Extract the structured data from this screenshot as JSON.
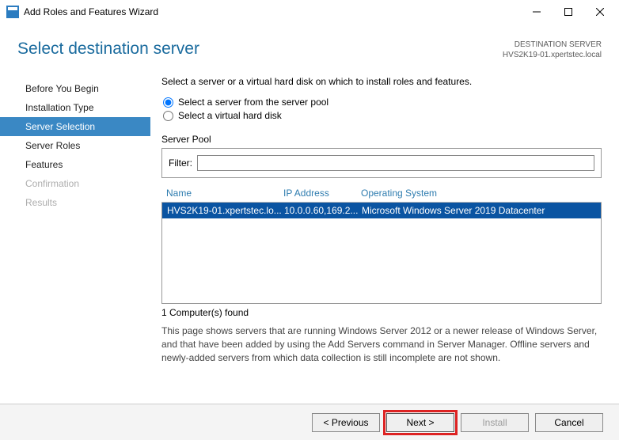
{
  "window": {
    "title": "Add Roles and Features Wizard"
  },
  "header": {
    "title": "Select destination server",
    "dest_label": "DESTINATION SERVER",
    "dest_value": "HVS2K19-01.xpertstec.local"
  },
  "sidebar": {
    "steps": [
      {
        "label": "Before You Begin",
        "state": "normal"
      },
      {
        "label": "Installation Type",
        "state": "normal"
      },
      {
        "label": "Server Selection",
        "state": "active"
      },
      {
        "label": "Server Roles",
        "state": "normal"
      },
      {
        "label": "Features",
        "state": "normal"
      },
      {
        "label": "Confirmation",
        "state": "disabled"
      },
      {
        "label": "Results",
        "state": "disabled"
      }
    ]
  },
  "content": {
    "intro": "Select a server or a virtual hard disk on which to install roles and features.",
    "radio_pool": "Select a server from the server pool",
    "radio_vhd": "Select a virtual hard disk",
    "pool_label": "Server Pool",
    "filter_label": "Filter:",
    "filter_value": "",
    "columns": {
      "name": "Name",
      "ip": "IP Address",
      "os": "Operating System"
    },
    "rows": [
      {
        "name": "HVS2K19-01.xpertstec.lo...",
        "ip": "10.0.0.60,169.2...",
        "os": "Microsoft Windows Server 2019 Datacenter"
      }
    ],
    "found": "1 Computer(s) found",
    "note": "This page shows servers that are running Windows Server 2012 or a newer release of Windows Server, and that have been added by using the Add Servers command in Server Manager. Offline servers and newly-added servers from which data collection is still incomplete are not shown."
  },
  "footer": {
    "previous": "< Previous",
    "next": "Next >",
    "install": "Install",
    "cancel": "Cancel"
  }
}
